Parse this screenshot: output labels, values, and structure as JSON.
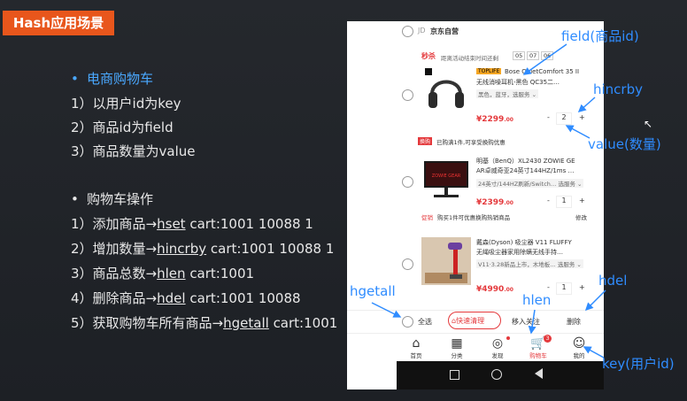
{
  "slide": {
    "title": "Hash应用场景",
    "section1_heading": "电商购物车",
    "section1_items": [
      "1）以用户id为key",
      "2）商品id为field",
      "3）商品数量为value"
    ],
    "section2_heading": "购物车操作",
    "ops": [
      {
        "prefix": "1）添加商品→",
        "cmd": "hset",
        "args": " cart:1001 10088 1"
      },
      {
        "prefix": "2）增加数量→",
        "cmd": "hincrby",
        "args": " cart:1001 10088 1"
      },
      {
        "prefix": "3）商品总数→",
        "cmd": "hlen",
        "args": " cart:1001"
      },
      {
        "prefix": "4）删除商品→",
        "cmd": "hdel",
        "args": " cart:1001 10088"
      },
      {
        "prefix": "5）获取购物车所有商品→",
        "cmd": "hgetall",
        "args": " cart:1001"
      }
    ]
  },
  "annotations": {
    "field": "field(商品id)",
    "hincrby": "hincrby",
    "value": "value(数量)",
    "hdel": "hdel",
    "hgetall": "hgetall",
    "hlen": "hlen",
    "key": "key(用户id)"
  },
  "phone": {
    "store": {
      "logo": "JD",
      "name": "京东自营"
    },
    "flash": {
      "label": "秒杀",
      "text": "距离活动结束时间还剩",
      "t1": "05",
      "t2": "07",
      "t3": "06"
    },
    "items": [
      {
        "tag": "TOPLIFE",
        "name1": "Bose QuietComfort 35 II",
        "name2": "无线消噪耳机-黑色 QC35二…",
        "spec": "黑色，蓝牙，选服务 ⌄",
        "price": "¥2299",
        "cents": ".00",
        "qty": "2"
      },
      {
        "name1": "明基（BenQ）XL2430 ZOWIE GE",
        "name2": "AR卓威奇亚24英寸144HZ/1ms …",
        "spec": "24英寸/144HZ刷新/Switch…  选服务 ⌄",
        "price": "¥2399",
        "cents": ".00",
        "qty": "1",
        "promo_tag": "促销",
        "promo_text": "购买1件可优惠换购热销商品",
        "promo_action": "修改",
        "product_logo": "ZOWIE GEAR"
      },
      {
        "name1": "戴森(Dyson) 吸尘器 V11 FLUFFY",
        "name2": "无绳吸尘器家用除螨无线手持…",
        "spec": "V11·3.28新品上市，木地板…  选服务 ⌄",
        "price": "¥4990",
        "cents": ".00",
        "qty": "1"
      }
    ],
    "coupon": {
      "tag": "换购",
      "text": "已购满1件,可享受换购优惠"
    },
    "footer": {
      "select_all": "全选",
      "clean": "快速清理",
      "move": "移入关注",
      "delete": "删除"
    },
    "nav": [
      "首页",
      "分类",
      "发现",
      "购物车",
      "我的"
    ],
    "cart_badge": "3"
  },
  "colors": {
    "accent_blue": "#2f8cff",
    "jd_red": "#e4393c",
    "title_orange": "#e8561c"
  }
}
